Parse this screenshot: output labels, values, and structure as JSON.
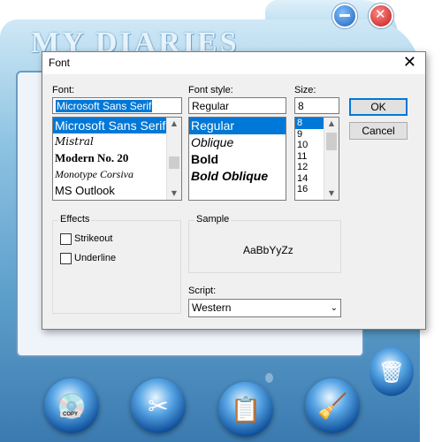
{
  "app": {
    "title": "MY DIARIES",
    "buttons": {
      "copy_label": "COPY",
      "copy_icon": "disc-copy-icon",
      "cut_icon": "scissors-icon",
      "paste_icon": "clipboard-icon",
      "clean_icon": "broom-icon",
      "trash_icon": "recycle-bin-icon"
    }
  },
  "dialog": {
    "title": "Font",
    "close_icon": "✕",
    "font": {
      "label": "Font:",
      "value": "Microsoft Sans Serif",
      "items": [
        "Microsoft Sans Serif",
        "Mistral",
        "Modern No. 20",
        "Monotype Corsiva",
        "MS Outlook"
      ],
      "selected_index": 0
    },
    "style": {
      "label": "Font style:",
      "value": "Regular",
      "items": [
        "Regular",
        "Oblique",
        "Bold",
        "Bold Oblique"
      ],
      "selected_index": 0
    },
    "size": {
      "label": "Size:",
      "value": "8",
      "items": [
        "8",
        "9",
        "10",
        "11",
        "12",
        "14",
        "16"
      ],
      "selected_index": 0
    },
    "ok_label": "OK",
    "cancel_label": "Cancel",
    "effects": {
      "label": "Effects",
      "strikeout": "Strikeout",
      "underline": "Underline"
    },
    "sample": {
      "label": "Sample",
      "text": "AaBbYyZz"
    },
    "script": {
      "label": "Script:",
      "value": "Western"
    }
  },
  "colors": {
    "selection": "#0078d7",
    "dialog_bg": "#f0f0f0"
  }
}
